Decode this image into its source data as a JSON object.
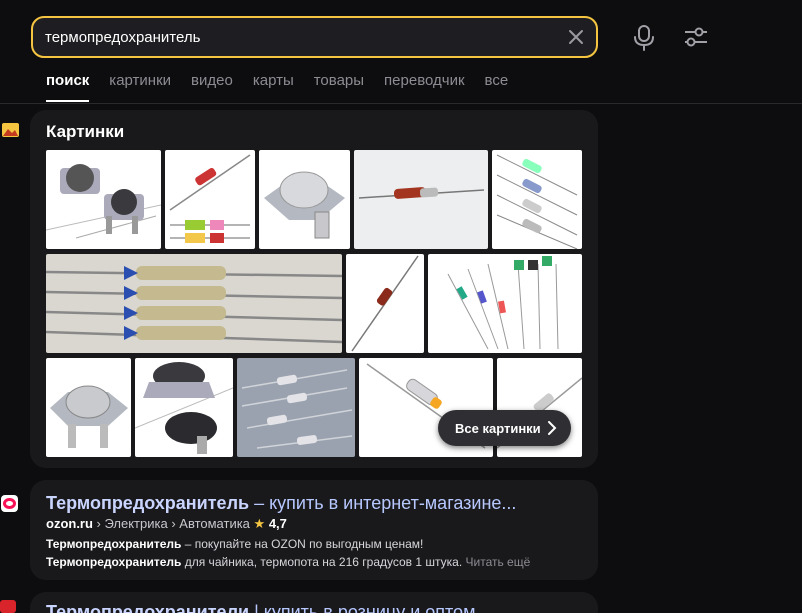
{
  "search": {
    "query": "термопредохранитель"
  },
  "tabs": [
    {
      "label": "поиск"
    },
    {
      "label": "картинки"
    },
    {
      "label": "видео"
    },
    {
      "label": "карты"
    },
    {
      "label": "товары"
    },
    {
      "label": "переводчик"
    },
    {
      "label": "все"
    }
  ],
  "images": {
    "title": "Картинки",
    "all_button": "Все картинки"
  },
  "results": [
    {
      "title_bold": "Термопредохранитель",
      "title_rest": " – купить в интернет-магазине...",
      "host": "ozon.ru",
      "sep1": " › ",
      "crumb1": "Электрика",
      "sep2": " › ",
      "crumb2": "Автоматика",
      "star": " ★ ",
      "rating": "4,7",
      "snippet1_bold": "Термопредохранитель",
      "snippet1_rest": " – покупайте на OZON по выгодным ценам!",
      "snippet2_bold": "Термопредохранитель",
      "snippet2_rest": " для чайника, термопота на 216 градусов 1 штука.",
      "read_more": " Читать ещё"
    },
    {
      "title_bold": "Термопредохранители",
      "title_rest": " | купить в розницу и оптом"
    }
  ],
  "colors": {
    "accent": "#f5c542",
    "link": "#b7c8ff",
    "background": "#0d0d0f",
    "card": "#19191c"
  }
}
